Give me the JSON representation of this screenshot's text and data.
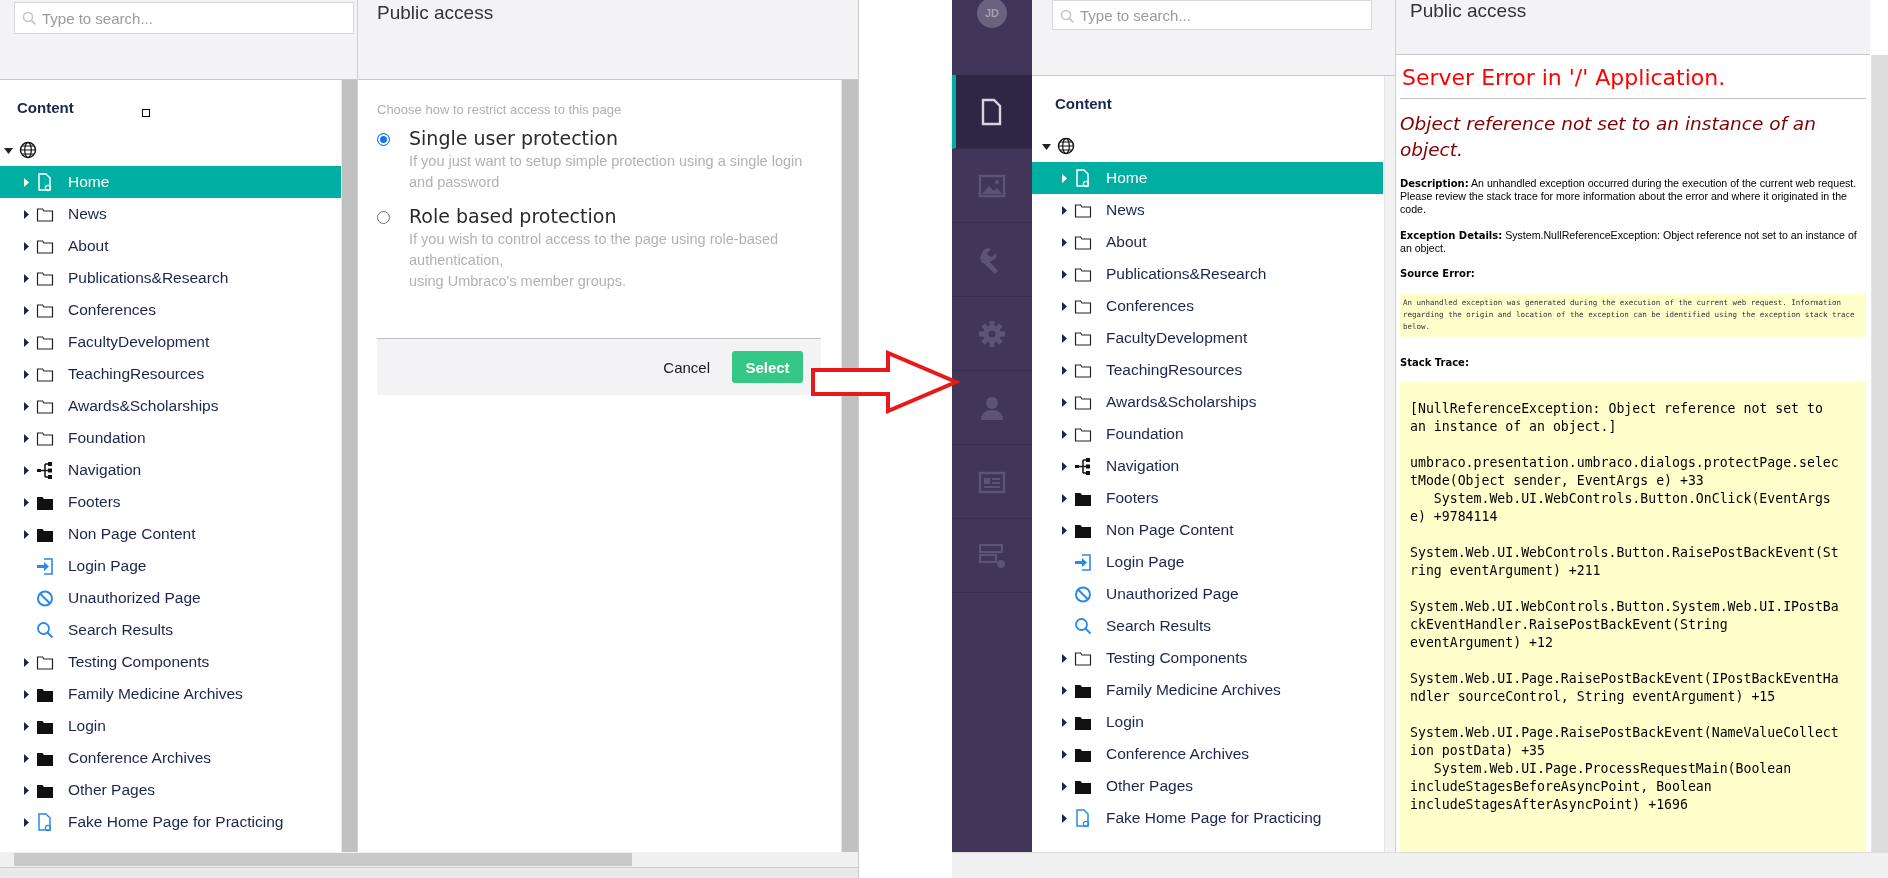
{
  "left_screen": {
    "search": {
      "placeholder": "Type to search..."
    },
    "tree_title": "Content",
    "tree": {
      "expanded": true,
      "children": [
        {
          "label": "Home",
          "kind": "page",
          "expandable": true,
          "selected": true
        },
        {
          "label": "News",
          "kind": "folder",
          "expandable": true,
          "selected": false
        },
        {
          "label": "About",
          "kind": "folder",
          "expandable": true,
          "selected": false
        },
        {
          "label": "Publications&Research",
          "kind": "folder",
          "expandable": true,
          "selected": false
        },
        {
          "label": "Conferences",
          "kind": "folder",
          "expandable": true,
          "selected": false
        },
        {
          "label": "FacultyDevelopment",
          "kind": "folder",
          "expandable": true,
          "selected": false
        },
        {
          "label": "TeachingResources",
          "kind": "folder",
          "expandable": true,
          "selected": false
        },
        {
          "label": "Awards&Scholarships",
          "kind": "folder",
          "expandable": true,
          "selected": false
        },
        {
          "label": "Foundation",
          "kind": "folder",
          "expandable": true,
          "selected": false
        },
        {
          "label": "Navigation",
          "kind": "sitemap",
          "expandable": true,
          "selected": false
        },
        {
          "label": "Footers",
          "kind": "folder-filled",
          "expandable": true,
          "selected": false
        },
        {
          "label": "Non Page Content",
          "kind": "folder-filled",
          "expandable": true,
          "selected": false
        },
        {
          "label": "Login Page",
          "kind": "login",
          "expandable": false,
          "selected": false
        },
        {
          "label": "Unauthorized Page",
          "kind": "ban",
          "expandable": false,
          "selected": false
        },
        {
          "label": "Search Results",
          "kind": "search",
          "expandable": false,
          "selected": false
        },
        {
          "label": "Testing Components",
          "kind": "folder",
          "expandable": true,
          "selected": false
        },
        {
          "label": "Family Medicine Archives",
          "kind": "folder-filled",
          "expandable": true,
          "selected": false
        },
        {
          "label": "Login",
          "kind": "folder-filled",
          "expandable": true,
          "selected": false
        },
        {
          "label": "Conference Archives",
          "kind": "folder-filled",
          "expandable": true,
          "selected": false
        },
        {
          "label": "Other Pages",
          "kind": "folder-filled",
          "expandable": true,
          "selected": false
        },
        {
          "label": "Fake Home Page for Practicing",
          "kind": "page",
          "expandable": true,
          "selected": false
        }
      ]
    },
    "dialog": {
      "title": "Public access",
      "intro": "Choose how to restrict access to this page",
      "options": [
        {
          "label": "Single user protection",
          "description": "If you just want to setup simple protection using a single login and password",
          "selected": true
        },
        {
          "label": "Role based protection",
          "description": "If you wish to control access to the page using role-based authentication,\nusing Umbraco's member groups.",
          "selected": false
        }
      ],
      "cancel": "Cancel",
      "select": "Select"
    }
  },
  "right_screen": {
    "avatar": "JD",
    "sections": [
      {
        "kind": "document",
        "selected": true
      },
      {
        "kind": "image",
        "selected": false
      },
      {
        "kind": "wrench",
        "selected": false
      },
      {
        "kind": "gear",
        "selected": false
      },
      {
        "kind": "person",
        "selected": false
      },
      {
        "kind": "id-card",
        "selected": false
      },
      {
        "kind": "form",
        "selected": false
      }
    ],
    "search": {
      "placeholder": "Type to search..."
    },
    "tree_title": "Content",
    "tree": {
      "expanded": true,
      "children": [
        {
          "label": "Home",
          "kind": "page",
          "expandable": true,
          "selected": true
        },
        {
          "label": "News",
          "kind": "folder",
          "expandable": true,
          "selected": false
        },
        {
          "label": "About",
          "kind": "folder",
          "expandable": true,
          "selected": false
        },
        {
          "label": "Publications&Research",
          "kind": "folder",
          "expandable": true,
          "selected": false
        },
        {
          "label": "Conferences",
          "kind": "folder",
          "expandable": true,
          "selected": false
        },
        {
          "label": "FacultyDevelopment",
          "kind": "folder",
          "expandable": true,
          "selected": false
        },
        {
          "label": "TeachingResources",
          "kind": "folder",
          "expandable": true,
          "selected": false
        },
        {
          "label": "Awards&Scholarships",
          "kind": "folder",
          "expandable": true,
          "selected": false
        },
        {
          "label": "Foundation",
          "kind": "folder",
          "expandable": true,
          "selected": false
        },
        {
          "label": "Navigation",
          "kind": "sitemap",
          "expandable": true,
          "selected": false
        },
        {
          "label": "Footers",
          "kind": "folder-filled",
          "expandable": true,
          "selected": false
        },
        {
          "label": "Non Page Content",
          "kind": "folder-filled",
          "expandable": true,
          "selected": false
        },
        {
          "label": "Login Page",
          "kind": "login",
          "expandable": false,
          "selected": false
        },
        {
          "label": "Unauthorized Page",
          "kind": "ban",
          "expandable": false,
          "selected": false
        },
        {
          "label": "Search Results",
          "kind": "search",
          "expandable": false,
          "selected": false
        },
        {
          "label": "Testing Components",
          "kind": "folder",
          "expandable": true,
          "selected": false
        },
        {
          "label": "Family Medicine Archives",
          "kind": "folder-filled",
          "expandable": true,
          "selected": false
        },
        {
          "label": "Login",
          "kind": "folder-filled",
          "expandable": true,
          "selected": false
        },
        {
          "label": "Conference Archives",
          "kind": "folder-filled",
          "expandable": true,
          "selected": false
        },
        {
          "label": "Other Pages",
          "kind": "folder-filled",
          "expandable": true,
          "selected": false
        },
        {
          "label": "Fake Home Page for Practicing",
          "kind": "page",
          "expandable": true,
          "selected": false
        }
      ]
    },
    "panel_title": "Public access",
    "error": {
      "heading": "Server Error in '/' Application.",
      "message": "Object reference not set to an instance of an object.",
      "description": "**Description:** An unhandled exception occurred during the execution of the current web request. Please review the stack trace for more information about the error and where it originated in the code.",
      "exception_details": "**Exception Details:** System.NullReferenceException: Object reference not set to an instance of an object.",
      "source_error_label": "Source Error:",
      "source_error": "An unhandled exception was generated during the execution of the current web request. Information regarding the origin and location of the exception can be identified using the exception stack trace below.",
      "stack_trace_label": "Stack Trace:",
      "stack_trace": "[NullReferenceException: Object reference not set to an instance of an object.]\n\numbraco.presentation.umbraco.dialogs.protectPage.selectMode(Object sender, EventArgs e) +33\n   System.Web.UI.WebControls.Button.OnClick(EventArgs e) +9784114\n\nSystem.Web.UI.WebControls.Button.RaisePostBackEvent(String eventArgument) +211\n\nSystem.Web.UI.WebControls.Button.System.Web.UI.IPostBackEventHandler.RaisePostBackEvent(String eventArgument) +12\n\nSystem.Web.UI.Page.RaisePostBackEvent(IPostBackEventHandler sourceControl, String eventArgument) +15\n\nSystem.Web.UI.Page.RaisePostBackEvent(NameValueCollection postData) +35\n   System.Web.UI.Page.ProcessRequestMain(Boolean includeStagesBeforeAsyncPoint, Boolean includeStagesAfterAsyncPoint) +1696"
    }
  }
}
